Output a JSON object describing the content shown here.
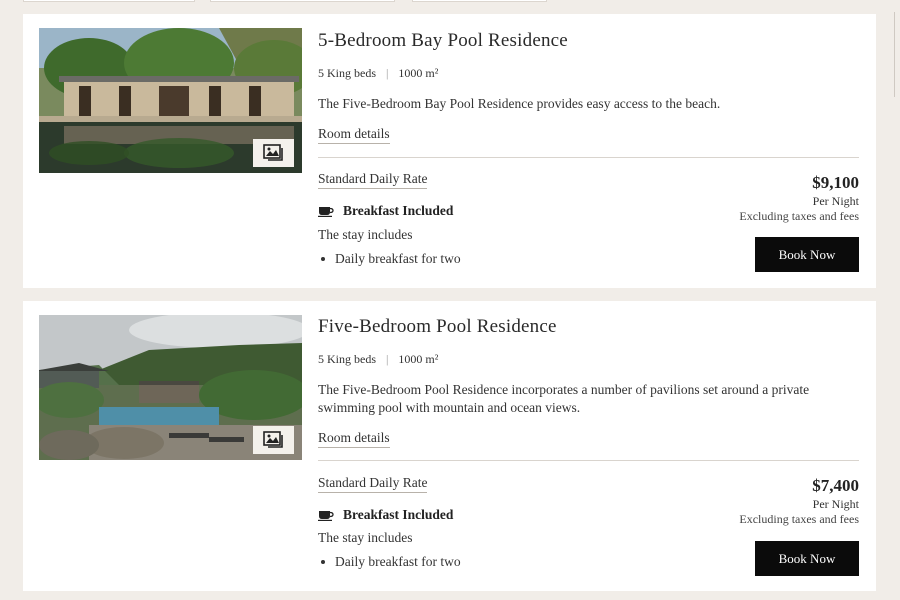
{
  "rooms": [
    {
      "title": "5-Bedroom Bay Pool Residence",
      "beds": "5 King beds",
      "separator": "|",
      "area": "1000 m²",
      "description": "The Five-Bedroom Bay Pool Residence provides easy access to the beach.",
      "details_link": "Room details",
      "rate_name": "Standard Daily Rate",
      "breakfast_label": "Breakfast Included",
      "stay_includes_label": "The stay includes",
      "inclusions": [
        "Daily breakfast for two"
      ],
      "price": "$9,100",
      "price_unit": "Per Night",
      "price_note": "Excluding taxes and fees",
      "book_label": "Book Now"
    },
    {
      "title": "Five-Bedroom Pool Residence",
      "beds": "5 King beds",
      "separator": "|",
      "area": "1000 m²",
      "description": "The Five-Bedroom Pool Residence incorporates a number of pavilions set around a private swimming pool with mountain and ocean views.",
      "details_link": "Room details",
      "rate_name": "Standard Daily Rate",
      "breakfast_label": "Breakfast Included",
      "stay_includes_label": "The stay includes",
      "inclusions": [
        "Daily breakfast for two"
      ],
      "price": "$7,400",
      "price_unit": "Per Night",
      "price_note": "Excluding taxes and fees",
      "book_label": "Book Now"
    }
  ],
  "icons": {
    "gallery": "gallery-icon",
    "breakfast": "coffee-cup-icon"
  },
  "colors": {
    "page_background": "#f1ede8",
    "card_background": "#ffffff",
    "book_button": "#0b0b0b"
  }
}
